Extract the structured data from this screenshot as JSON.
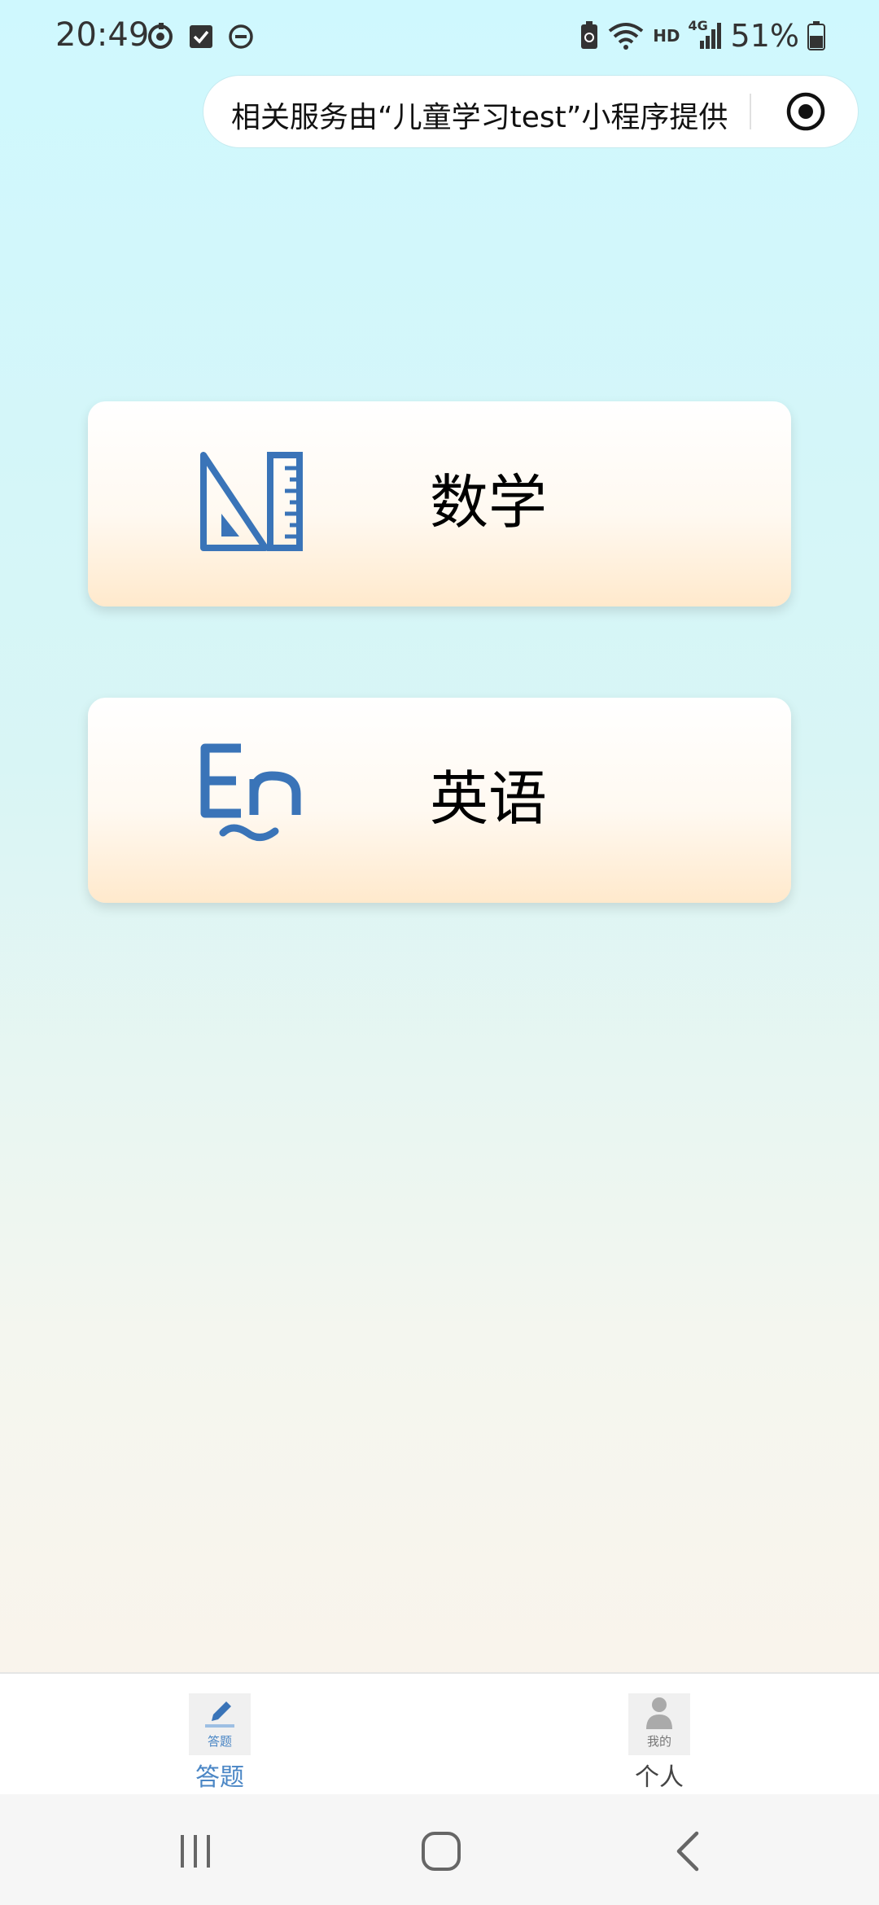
{
  "status_bar": {
    "time": "20:49",
    "network_label": "HD",
    "network_type": "4G",
    "battery": "51%"
  },
  "capsule": {
    "text": "相关服务由“儿童学习test”小程序提供"
  },
  "subjects": [
    {
      "label": "数学",
      "icon": "ruler-triangle-icon"
    },
    {
      "label": "英语",
      "icon": "en-letters-icon"
    }
  ],
  "tab_bar": {
    "tabs": [
      {
        "label": "答题",
        "thumb_label": "答题",
        "active": true,
        "icon": "pencil-icon"
      },
      {
        "label": "个人",
        "thumb_label": "我的",
        "active": false,
        "icon": "person-icon"
      }
    ]
  },
  "colors": {
    "accent": "#3a74b8",
    "tab_active": "#4a86c5",
    "card_bottom": "#ffe9cc",
    "bg_top": "#cff8fe",
    "bg_bottom": "#fdf3ea"
  }
}
